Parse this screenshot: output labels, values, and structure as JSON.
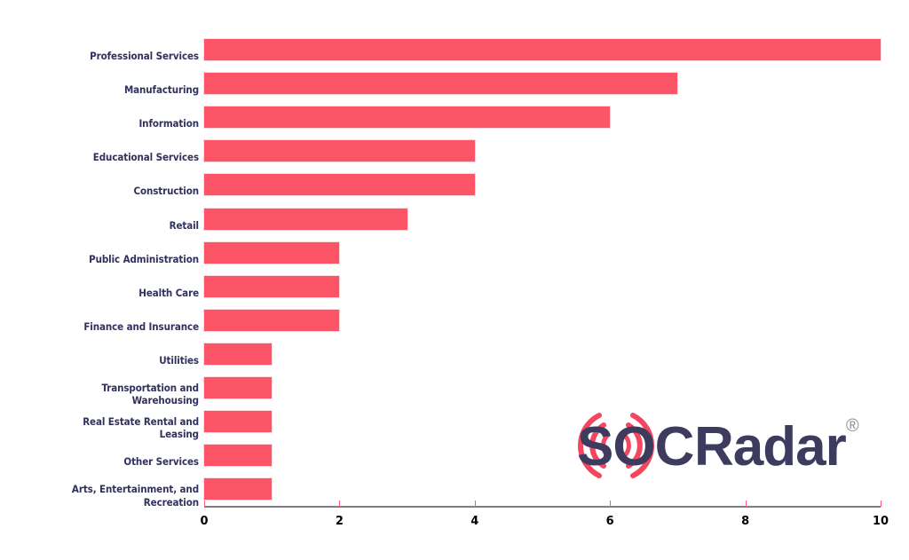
{
  "chart_data": {
    "type": "bar",
    "orientation": "horizontal",
    "title": "",
    "subtitle": "",
    "xlabel": "",
    "ylabel": "",
    "xlim": [
      0,
      10
    ],
    "xticks": [
      0,
      2,
      4,
      6,
      8,
      10
    ],
    "xtick_labels": [
      "0",
      "2",
      "4",
      "6",
      "8",
      "10"
    ],
    "grid": false,
    "legend": null,
    "bar_color": "#fb5567",
    "label_color": "#31315e",
    "axis_color": "#7e7e7e",
    "tick_color": "#f7607a",
    "categories": [
      "Professional Services",
      "Manufacturing",
      "Information",
      "Educational Services",
      "Construction",
      "Retail",
      "Public Administration",
      "Health Care",
      "Finance and Insurance",
      "Utilities",
      "Transportation and\nWarehousing",
      "Real Estate Rental and\nLeasing",
      "Other Services",
      "Arts, Entertainment, and\nRecreation"
    ],
    "values": [
      10,
      7,
      6,
      4,
      4,
      3,
      2,
      2,
      2,
      1,
      1,
      1,
      1,
      1
    ]
  },
  "watermark": {
    "brand_text_1": "SOC",
    "brand_text_2": "Radar",
    "registered_mark": "®",
    "brand_color": "#3d3b5e",
    "arc_color": "#f4465e",
    "mark_color": "#8a8a99"
  }
}
